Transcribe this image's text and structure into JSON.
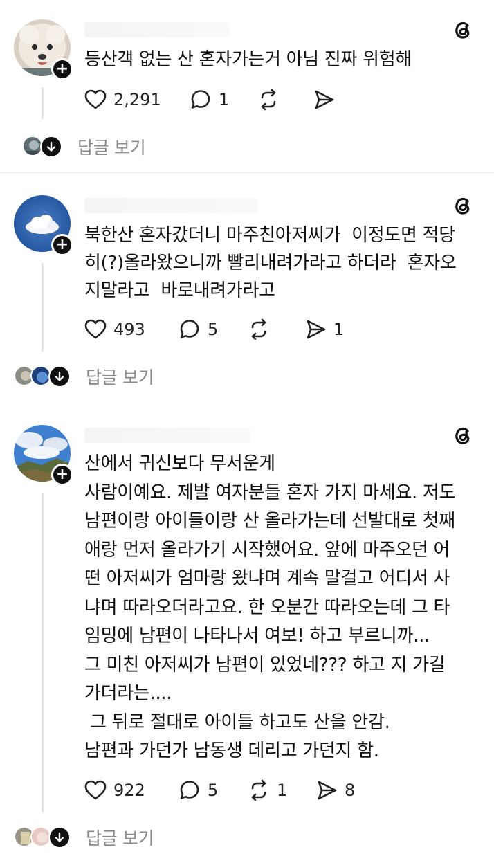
{
  "posts": [
    {
      "text": "등산객 없는 산 혼자가는거 아님 진짜 위험해",
      "likes": "2,291",
      "comments": "1",
      "reposts": "",
      "shares": "",
      "replies_label": "답글 보기"
    },
    {
      "text": "북한산 혼자갔더니 마주친아저씨가  이정도면 적당\n히(?)올라왔으니까 빨리내려가라고 하더라  혼자오\n지말라고  바로내려가라고",
      "likes": "493",
      "comments": "5",
      "reposts": "",
      "shares": "1",
      "replies_label": "답글 보기"
    },
    {
      "text": "산에서 귀신보다 무서운게\n사람이예요. 제발 여자분들 혼자 가지 마세요. 저도\n남편이랑 아이들이랑 산 올라가는데 선발대로 첫째\n애랑 먼저 올라가기 시작했어요. 앞에 마주오던 어\n떤 아저씨가 엄마랑 왔냐며 계속 말걸고 어디서 사\n냐며 따라오더라고요. 한 오분간 따라오는데 그 타\n임밍에 남편이 나타나서 여보! 하고 부르니까...\n그 미친 아저씨가 남편이 있었네??? 하고 지 가길\n가더라는....\n 그 뒤로 절대로 아이들 하고도 산을 안감.\n남편과 가던가 남동생 데리고 가던지 함.",
      "likes": "922",
      "comments": "5",
      "reposts": "1",
      "shares": "8",
      "replies_label": "답글 보기"
    }
  ]
}
